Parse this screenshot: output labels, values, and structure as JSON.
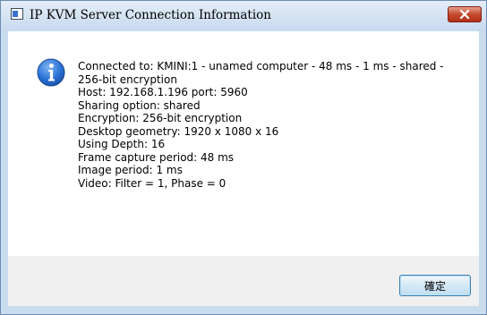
{
  "window": {
    "title": "IP KVM Server Connection Information"
  },
  "message": {
    "lines": [
      "Connected to: KMINI:1 - unamed computer - 48 ms - 1 ms - shared - 256-bit encryption",
      "Host: 192.168.1.196  port: 5960",
      "Sharing option: shared",
      "Encryption: 256-bit encryption",
      "Desktop geometry: 1920 x 1080 x 16",
      "Using Depth: 16",
      "Frame capture period: 48 ms",
      "Image period: 1 ms",
      "Video: Filter = 1, Phase = 0"
    ]
  },
  "buttons": {
    "ok_label": "確定"
  },
  "icons": {
    "window": "app-window-icon",
    "close": "close-icon",
    "info": "info-icon"
  },
  "colors": {
    "close_button": "#c54a2c",
    "info_icon": "#1e63c8",
    "frame": "#c9dcee"
  }
}
